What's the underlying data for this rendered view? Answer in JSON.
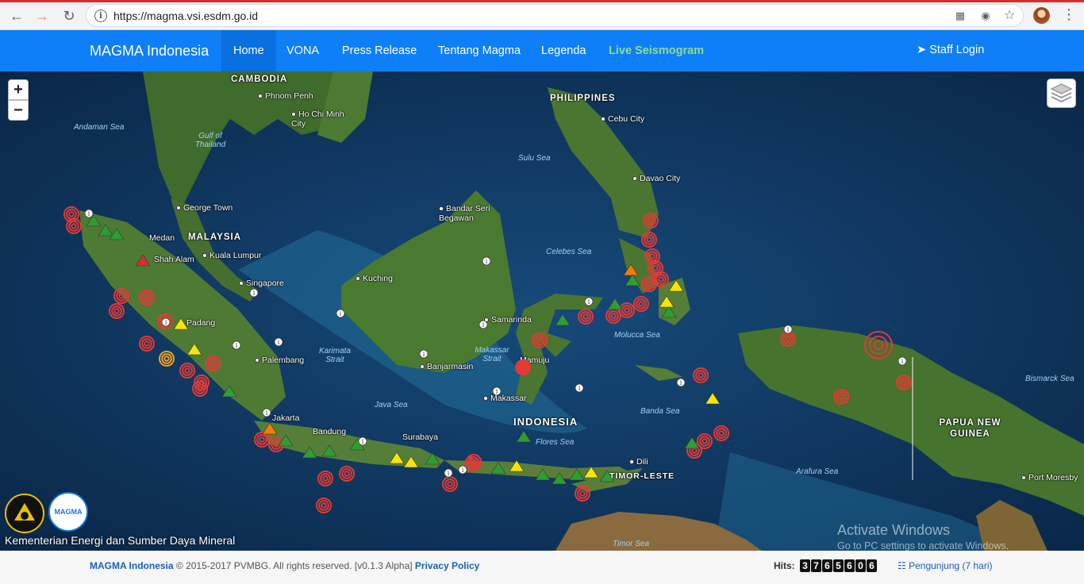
{
  "browser": {
    "url": "https://magma.vsi.esdm.go.id",
    "info_icon": "info-icon",
    "icons": [
      "back-arrow-icon",
      "forward-arrow-icon",
      "reload-icon",
      "blocked-content-icon",
      "extension-icon",
      "star-icon",
      "profile-avatar-icon",
      "menu-kebab-icon"
    ]
  },
  "navbar": {
    "brand": "MAGMA Indonesia",
    "links": [
      "Home",
      "VONA",
      "Press Release",
      "Tentang Magma",
      "Legenda",
      "Live Seismogram"
    ],
    "active": "Home",
    "staff_login": "Staff Login",
    "colors": {
      "bar": "#0f7ff7",
      "live": "#8fdc8f"
    }
  },
  "map": {
    "zoom_in": "+",
    "zoom_out": "−",
    "labels": {
      "countries": [
        "CAMBODIA",
        "PHILIPPINES",
        "MALAYSIA",
        "INDONESIA",
        "PAPUA NEW GUINEA",
        "TIMOR-LESTE"
      ],
      "seas": [
        "Andaman Sea",
        "Gulf of Thailand",
        "Sulu Sea",
        "Celebes Sea",
        "Karimata Strait",
        "Makassar Strait",
        "Java Sea",
        "Flores Sea",
        "Banda Sea",
        "Molucca Sea",
        "Bismarck Sea",
        "Arafura Sea",
        "Timor Sea"
      ],
      "cities": [
        "Phnom Penh",
        "Ho Chi Minh City",
        "Cebu City",
        "Davao City",
        "George Town",
        "Medan",
        "Shah Alam",
        "Kuala Lumpur",
        "Singapore",
        "Bandar Seri Begawan",
        "Kuching",
        "Palembang",
        "Jakarta",
        "Bandung",
        "Surabaya",
        "Banjarmasin",
        "Samarinda",
        "Mamuju",
        "Makassar",
        "Dili",
        "Port Moresby",
        "Padang"
      ]
    },
    "legend_colors": {
      "normal": "#2e9d32",
      "waspada": "#f5e600",
      "siaga": "#f57c00",
      "awas": "#d32f2f",
      "earthquake": "#e53935"
    },
    "footer_caption": "Kementerian Energi dan Sumber Daya Mineral",
    "logos": [
      "esdm-logo-icon",
      "magma-logo-icon"
    ]
  },
  "watermark": {
    "title": "Activate Windows",
    "subtitle": "Go to PC settings to activate Windows."
  },
  "footer": {
    "brand": "MAGMA Indonesia",
    "copyright": "© 2015-2017 PVMBG. All rights reserved. [v0.1.3 Alpha]",
    "privacy": "Privacy Policy",
    "hits_label": "Hits:",
    "hits_digits": [
      "3",
      "7",
      "6",
      "5",
      "6",
      "0",
      "6"
    ],
    "pengunjung": "Pengunjung (7 hari)"
  }
}
